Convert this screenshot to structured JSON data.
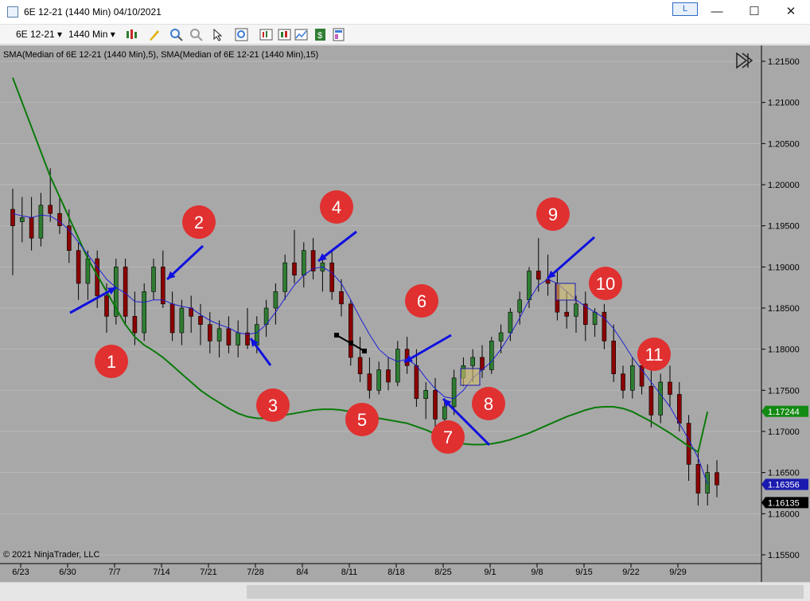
{
  "window": {
    "title": "6E 12-21 (1440 Min)  04/10/2021",
    "link_label": "L",
    "minimize": "—",
    "maximize": "☐",
    "close": "✕"
  },
  "toolbar": {
    "instrument": "6E 12-21",
    "interval": "1440 Min"
  },
  "chart": {
    "indicator_label": "SMA(Median of 6E 12-21 (1440 Min),5), SMA(Median of 6E 12-21 (1440 Min),15)",
    "copyright": "© 2021 NinjaTrader, LLC",
    "colors": {
      "background": "#a8a8a8",
      "fast_sma": "#1f1fd6",
      "slow_sma": "#0a7a0a",
      "up_candle": "#2e7d32",
      "down_candle": "#8b0000",
      "arrow": "#1010e0",
      "marker": "#e03030"
    },
    "price_labels": {
      "slow_sma": "1.17244",
      "fast_sma": "1.16356",
      "last": "1.16135"
    }
  },
  "chart_data": {
    "type": "candlestick",
    "ylim": [
      1.155,
      1.2175
    ],
    "y_ticks": [
      "1.21500",
      "1.21000",
      "1.20500",
      "1.20000",
      "1.19500",
      "1.19000",
      "1.18500",
      "1.18000",
      "1.17500",
      "1.17000",
      "1.16500",
      "1.16000",
      "1.15500"
    ],
    "x_ticks": [
      "6/23",
      "6/30",
      "7/7",
      "7/14",
      "7/21",
      "7/28",
      "8/4",
      "8/11",
      "8/18",
      "8/25",
      "9/1",
      "9/8",
      "9/15",
      "9/22",
      "9/29"
    ],
    "candles": [
      [
        1.197,
        1.1995,
        1.189,
        1.195
      ],
      [
        1.1955,
        1.1985,
        1.193,
        1.196
      ],
      [
        1.196,
        1.1985,
        1.192,
        1.1935
      ],
      [
        1.1935,
        1.199,
        1.1925,
        1.1975
      ],
      [
        1.1975,
        1.202,
        1.1955,
        1.1965
      ],
      [
        1.1965,
        1.1985,
        1.194,
        1.195
      ],
      [
        1.195,
        1.197,
        1.1905,
        1.192
      ],
      [
        1.192,
        1.193,
        1.186,
        1.188
      ],
      [
        1.188,
        1.192,
        1.186,
        1.191
      ],
      [
        1.191,
        1.192,
        1.185,
        1.1865
      ],
      [
        1.1865,
        1.188,
        1.182,
        1.184
      ],
      [
        1.184,
        1.191,
        1.183,
        1.19
      ],
      [
        1.19,
        1.191,
        1.183,
        1.184
      ],
      [
        1.184,
        1.187,
        1.1805,
        1.182
      ],
      [
        1.182,
        1.188,
        1.181,
        1.187
      ],
      [
        1.187,
        1.191,
        1.186,
        1.19
      ],
      [
        1.19,
        1.192,
        1.185,
        1.1855
      ],
      [
        1.1855,
        1.187,
        1.181,
        1.182
      ],
      [
        1.182,
        1.186,
        1.1805,
        1.185
      ],
      [
        1.185,
        1.1865,
        1.182,
        1.184
      ],
      [
        1.184,
        1.1855,
        1.1805,
        1.183
      ],
      [
        1.183,
        1.1845,
        1.1795,
        1.181
      ],
      [
        1.181,
        1.1835,
        1.179,
        1.1825
      ],
      [
        1.1825,
        1.184,
        1.1795,
        1.1805
      ],
      [
        1.1805,
        1.1835,
        1.179,
        1.182
      ],
      [
        1.182,
        1.185,
        1.18,
        1.1805
      ],
      [
        1.1805,
        1.184,
        1.1795,
        1.183
      ],
      [
        1.183,
        1.186,
        1.1815,
        1.185
      ],
      [
        1.185,
        1.188,
        1.183,
        1.187
      ],
      [
        1.187,
        1.1915,
        1.186,
        1.1905
      ],
      [
        1.1905,
        1.1945,
        1.188,
        1.189
      ],
      [
        1.189,
        1.193,
        1.1875,
        1.192
      ],
      [
        1.192,
        1.1935,
        1.1885,
        1.1895
      ],
      [
        1.1895,
        1.1915,
        1.187,
        1.1905
      ],
      [
        1.1905,
        1.192,
        1.186,
        1.187
      ],
      [
        1.187,
        1.1885,
        1.184,
        1.1855
      ],
      [
        1.1855,
        1.186,
        1.178,
        1.179
      ],
      [
        1.179,
        1.1815,
        1.176,
        1.177
      ],
      [
        1.177,
        1.179,
        1.174,
        1.175
      ],
      [
        1.175,
        1.1785,
        1.1745,
        1.1775
      ],
      [
        1.1775,
        1.179,
        1.175,
        1.176
      ],
      [
        1.176,
        1.181,
        1.1755,
        1.18
      ],
      [
        1.18,
        1.1815,
        1.177,
        1.178
      ],
      [
        1.178,
        1.18,
        1.173,
        1.174
      ],
      [
        1.174,
        1.176,
        1.1715,
        1.175
      ],
      [
        1.175,
        1.1765,
        1.17,
        1.1715
      ],
      [
        1.1715,
        1.174,
        1.1695,
        1.173
      ],
      [
        1.173,
        1.1775,
        1.172,
        1.1765
      ],
      [
        1.1765,
        1.179,
        1.1755,
        1.178
      ],
      [
        1.178,
        1.18,
        1.176,
        1.179
      ],
      [
        1.179,
        1.1805,
        1.1765,
        1.1775
      ],
      [
        1.1775,
        1.1815,
        1.177,
        1.181
      ],
      [
        1.181,
        1.183,
        1.1795,
        1.182
      ],
      [
        1.182,
        1.185,
        1.181,
        1.1845
      ],
      [
        1.1845,
        1.187,
        1.183,
        1.186
      ],
      [
        1.186,
        1.19,
        1.185,
        1.1895
      ],
      [
        1.1895,
        1.1935,
        1.187,
        1.1885
      ],
      [
        1.1885,
        1.1915,
        1.1865,
        1.188
      ],
      [
        1.188,
        1.1895,
        1.1835,
        1.1845
      ],
      [
        1.1845,
        1.187,
        1.1825,
        1.184
      ],
      [
        1.184,
        1.1865,
        1.182,
        1.1855
      ],
      [
        1.1855,
        1.187,
        1.181,
        1.183
      ],
      [
        1.183,
        1.185,
        1.1815,
        1.1845
      ],
      [
        1.1845,
        1.1855,
        1.18,
        1.181
      ],
      [
        1.181,
        1.183,
        1.176,
        1.177
      ],
      [
        1.177,
        1.178,
        1.174,
        1.175
      ],
      [
        1.175,
        1.179,
        1.174,
        1.178
      ],
      [
        1.178,
        1.18,
        1.1745,
        1.1755
      ],
      [
        1.1755,
        1.178,
        1.1705,
        1.172
      ],
      [
        1.172,
        1.177,
        1.171,
        1.176
      ],
      [
        1.176,
        1.178,
        1.173,
        1.1745
      ],
      [
        1.1745,
        1.176,
        1.17,
        1.171
      ],
      [
        1.171,
        1.172,
        1.164,
        1.166
      ],
      [
        1.166,
        1.1675,
        1.161,
        1.1625
      ],
      [
        1.1625,
        1.166,
        1.161,
        1.165
      ],
      [
        1.165,
        1.1665,
        1.162,
        1.1635
      ]
    ],
    "slow_sma": [
      1.213,
      1.21,
      1.207,
      1.204,
      1.201,
      1.1985,
      1.196,
      1.1935,
      1.191,
      1.189,
      1.187,
      1.185,
      1.183,
      1.1815,
      1.1805,
      1.1798,
      1.179,
      1.178,
      1.177,
      1.176,
      1.175,
      1.1742,
      1.1735,
      1.1728,
      1.1722,
      1.1718,
      1.1716,
      1.1716,
      1.1718,
      1.172,
      1.1722,
      1.1724,
      1.1726,
      1.1727,
      1.1727,
      1.1726,
      1.1724,
      1.1721,
      1.1718,
      1.1716,
      1.1714,
      1.1712,
      1.171,
      1.1706,
      1.1702,
      1.1697,
      1.1692,
      1.1688,
      1.1685,
      1.1684,
      1.1684,
      1.1685,
      1.1687,
      1.169,
      1.1694,
      1.1698,
      1.1703,
      1.1708,
      1.1713,
      1.1718,
      1.1722,
      1.1726,
      1.1729,
      1.173,
      1.173,
      1.1728,
      1.1724,
      1.1718,
      1.1712,
      1.1705,
      1.1698,
      1.169,
      1.1682,
      1.1675,
      1.1724
    ],
    "fast_sma": [
      1.1965,
      1.1962,
      1.196,
      1.1963,
      1.1962,
      1.1955,
      1.1945,
      1.193,
      1.1915,
      1.19,
      1.1885,
      1.1875,
      1.1868,
      1.1858,
      1.1857,
      1.186,
      1.186,
      1.1855,
      1.1852,
      1.185,
      1.1842,
      1.1835,
      1.183,
      1.1826,
      1.182,
      1.1818,
      1.182,
      1.183,
      1.1845,
      1.1862,
      1.1878,
      1.189,
      1.1898,
      1.19,
      1.1893,
      1.188,
      1.186,
      1.1838,
      1.1818,
      1.18,
      1.179,
      1.1785,
      1.1788,
      1.178,
      1.1765,
      1.1752,
      1.1742,
      1.174,
      1.175,
      1.1765,
      1.1775,
      1.1785,
      1.18,
      1.1818,
      1.1838,
      1.186,
      1.1878,
      1.1885,
      1.188,
      1.187,
      1.186,
      1.1852,
      1.1845,
      1.1838,
      1.1825,
      1.1808,
      1.179,
      1.1775,
      1.176,
      1.1745,
      1.173,
      1.171,
      1.169,
      1.1668,
      1.1636
    ]
  }
}
